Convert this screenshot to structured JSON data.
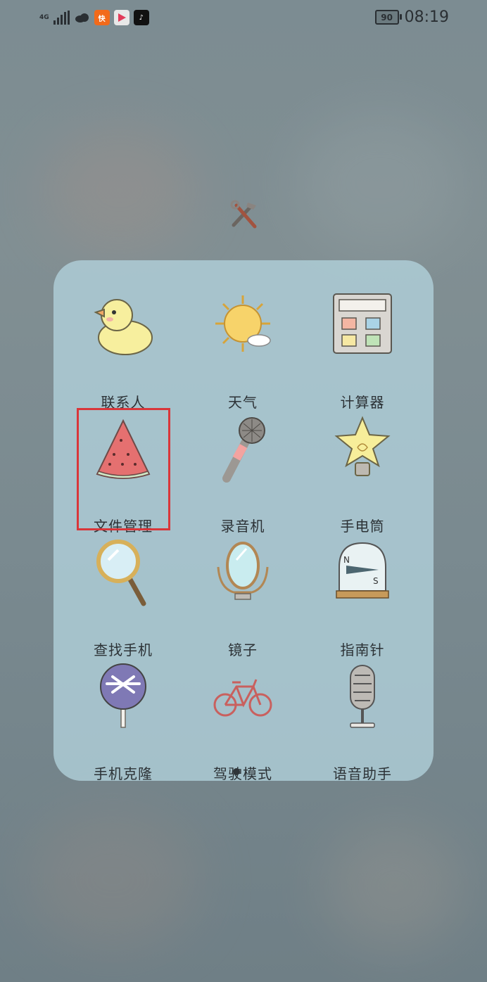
{
  "status_bar": {
    "network": "4G",
    "time": "08:19",
    "battery": "90"
  },
  "folder": {
    "apps": [
      {
        "label": "联系人",
        "icon": "duck-icon"
      },
      {
        "label": "天气",
        "icon": "sun-cloud-icon"
      },
      {
        "label": "计算器",
        "icon": "calculator-icon"
      },
      {
        "label": "文件管理",
        "icon": "watermelon-icon"
      },
      {
        "label": "录音机",
        "icon": "microphone-icon"
      },
      {
        "label": "手电筒",
        "icon": "lightbulb-star-icon"
      },
      {
        "label": "查找手机",
        "icon": "magnifier-icon"
      },
      {
        "label": "镜子",
        "icon": "mirror-icon"
      },
      {
        "label": "指南针",
        "icon": "compass-icon"
      },
      {
        "label": "手机克隆",
        "icon": "fan-icon"
      },
      {
        "label": "驾驶模式",
        "icon": "bicycle-icon"
      },
      {
        "label": "语音助手",
        "icon": "vintage-mic-icon"
      }
    ],
    "highlighted_app": "文件管理",
    "page_indicator": {
      "current": 1,
      "total": 2
    }
  },
  "colors": {
    "highlight": "#d9363a",
    "folder_bg": "#b2d2dc"
  }
}
